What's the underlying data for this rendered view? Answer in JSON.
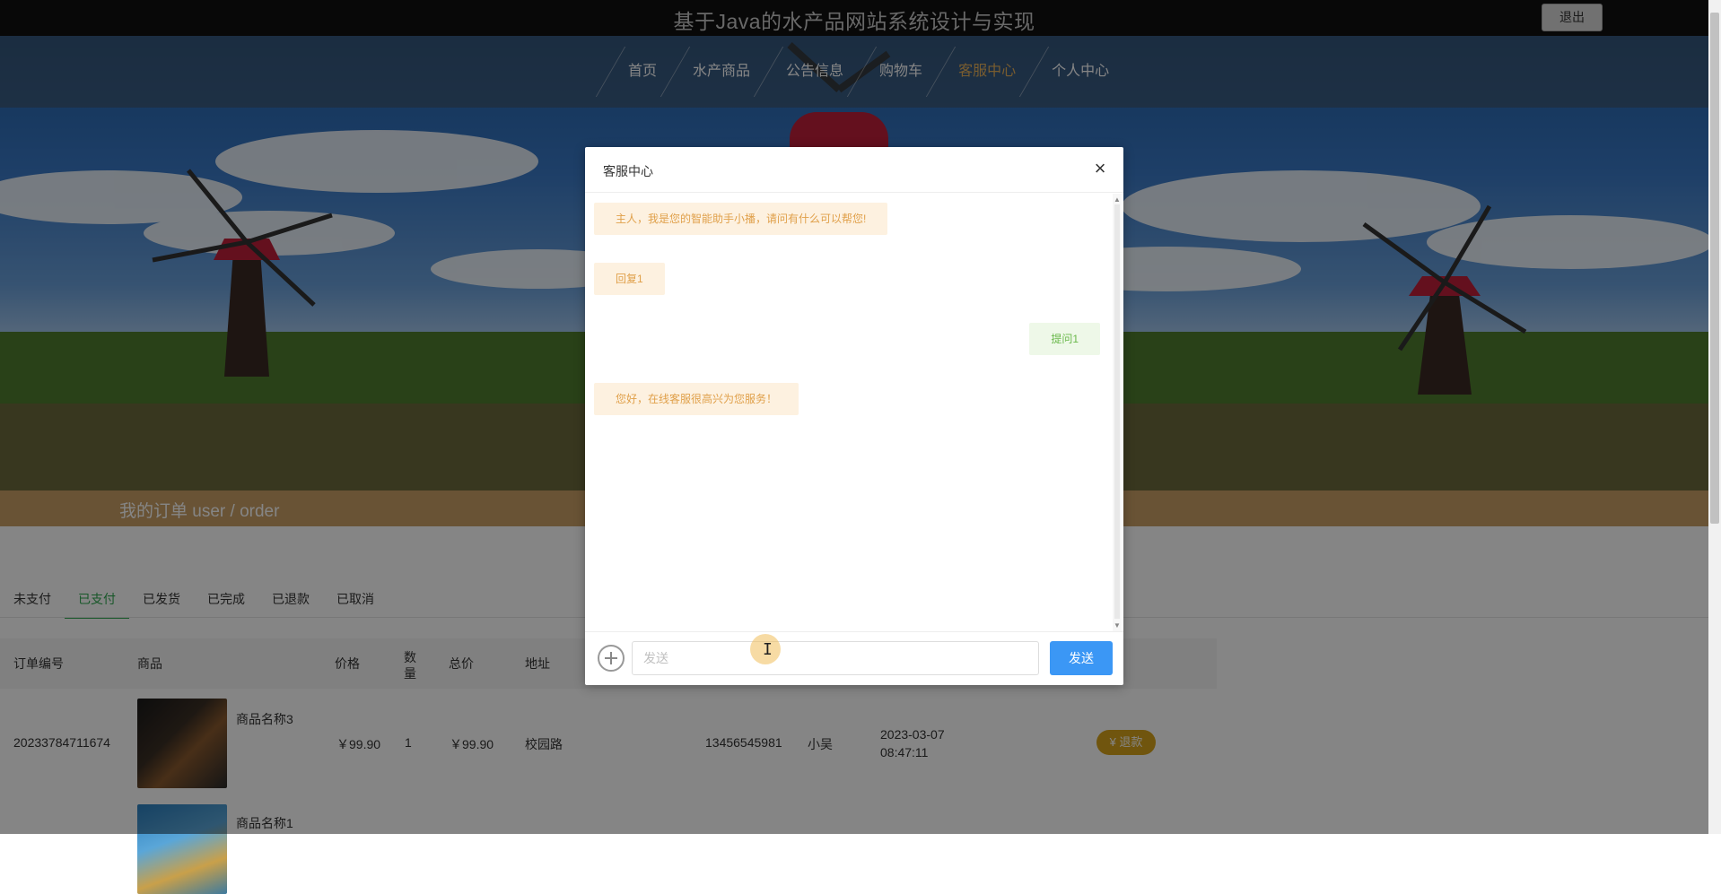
{
  "header": {
    "site_title": "基于Java的水产品网站系统设计与实现",
    "logout_label": "退出"
  },
  "nav": {
    "items": [
      {
        "label": "首页",
        "active": false
      },
      {
        "label": "水产商品",
        "active": false
      },
      {
        "label": "公告信息",
        "active": false
      },
      {
        "label": "购物车",
        "active": false
      },
      {
        "label": "客服中心",
        "active": true
      },
      {
        "label": "个人中心",
        "active": false
      }
    ]
  },
  "order_banner": {
    "label": "我的订单  user / order"
  },
  "tabs": [
    {
      "label": "未支付",
      "active": false
    },
    {
      "label": "已支付",
      "active": true
    },
    {
      "label": "已发货",
      "active": false
    },
    {
      "label": "已完成",
      "active": false
    },
    {
      "label": "已退款",
      "active": false
    },
    {
      "label": "已取消",
      "active": false
    }
  ],
  "table": {
    "headers": {
      "order_no": "订单编号",
      "product": "商品",
      "price": "价格",
      "qty": "数量",
      "total": "总价",
      "address": "地址"
    },
    "rows": [
      {
        "order_no": "20233784711674",
        "product_name": "商品名称3",
        "price": "￥99.90",
        "qty": "1",
        "total": "￥99.90",
        "address": "校园路",
        "phone": "13456545981",
        "name": "小吴",
        "date": "2023-03-07",
        "time": "08:47:11",
        "action": "退款"
      },
      {
        "product_name": "商品名称1"
      }
    ]
  },
  "modal": {
    "title": "客服中心",
    "messages": [
      {
        "side": "left",
        "text": "主人，我是您的智能助手小播，请问有什么可以帮您!"
      },
      {
        "side": "left",
        "text": "回复1"
      },
      {
        "side": "right",
        "text": "提问1"
      },
      {
        "side": "left",
        "text": "您好，在线客服很高兴为您服务！"
      }
    ],
    "input_placeholder": "发送",
    "send_label": "发送"
  },
  "colors": {
    "accent_orange": "#e7b15a",
    "order_band": "#c9a066",
    "tab_active": "#2fa84f",
    "send_button": "#3b97f5",
    "refund_button": "#d7a31b"
  }
}
